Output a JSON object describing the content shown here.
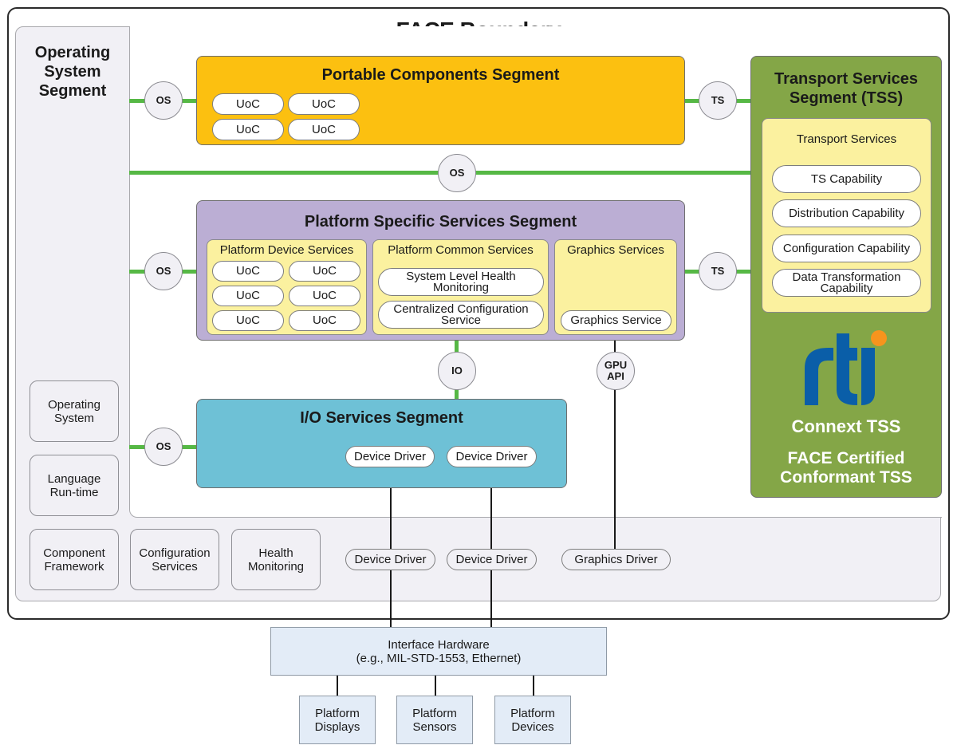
{
  "title": "FACE Boundary",
  "os_segment": {
    "title": "Operating System Segment",
    "title_lines": [
      "Operating",
      "System",
      "Segment"
    ],
    "blocks": [
      {
        "label_lines": [
          "Operating",
          "System"
        ]
      },
      {
        "label_lines": [
          "Language",
          "Run-time"
        ]
      },
      {
        "label_lines": [
          "Component",
          "Framework"
        ]
      },
      {
        "label_lines": [
          "Configuration",
          "Services"
        ]
      },
      {
        "label_lines": [
          "Health",
          "Monitoring"
        ]
      }
    ],
    "drivers": [
      "Device Driver",
      "Device Driver",
      "Graphics Driver"
    ]
  },
  "interfaces": {
    "os": "OS",
    "ts": "TS",
    "io": "IO",
    "gpu_api_lines": [
      "GPU",
      "API"
    ]
  },
  "portable_components": {
    "title": "Portable Components Segment",
    "uocs": [
      "UoC",
      "UoC",
      "UoC",
      "UoC"
    ]
  },
  "platform_specific": {
    "title": "Platform Specific Services Segment",
    "device_services": {
      "title": "Platform Device Services",
      "uocs": [
        "UoC",
        "UoC",
        "UoC",
        "UoC",
        "UoC",
        "UoC"
      ]
    },
    "common_services": {
      "title": "Platform Common Services",
      "items": [
        {
          "lines": [
            "System Level Health",
            "Monitoring"
          ]
        },
        {
          "lines": [
            "Centralized Configuration",
            "Service"
          ]
        }
      ]
    },
    "graphics_services": {
      "title": "Graphics Services",
      "item": "Graphics Service"
    }
  },
  "io_services": {
    "title": "I/O Services Segment",
    "drivers": [
      "Device Driver",
      "Device Driver"
    ]
  },
  "transport_services": {
    "title_lines": [
      "Transport Services",
      "Segment (TSS)"
    ],
    "inner_title": "Transport Services",
    "capabilities": [
      {
        "lines": [
          "TS Capability"
        ]
      },
      {
        "lines": [
          "Distribution Capability"
        ]
      },
      {
        "lines": [
          "Configuration Capability"
        ]
      },
      {
        "lines": [
          "Data Transformation",
          "Capability"
        ]
      }
    ],
    "logo_text": "rti",
    "product": "Connext TSS",
    "certification_lines": [
      "FACE Certified",
      "Conformant TSS"
    ]
  },
  "hardware": {
    "interface_lines": [
      "Interface Hardware",
      "(e.g., MIL-STD-1553, Ethernet)"
    ],
    "devices": [
      {
        "lines": [
          "Platform",
          "Displays"
        ]
      },
      {
        "lines": [
          "Platform",
          "Sensors"
        ]
      },
      {
        "lines": [
          "Platform",
          "Devices"
        ]
      }
    ]
  },
  "colors": {
    "portable": "#fcc010",
    "platform_specific": "#bbaed4",
    "sub_yellow": "#fbf19f",
    "io": "#6ec1d6",
    "tss": "#84a647",
    "connector_green": "#56b845",
    "rti_blue": "#0a5ea8",
    "rti_orange": "#f7941d"
  }
}
